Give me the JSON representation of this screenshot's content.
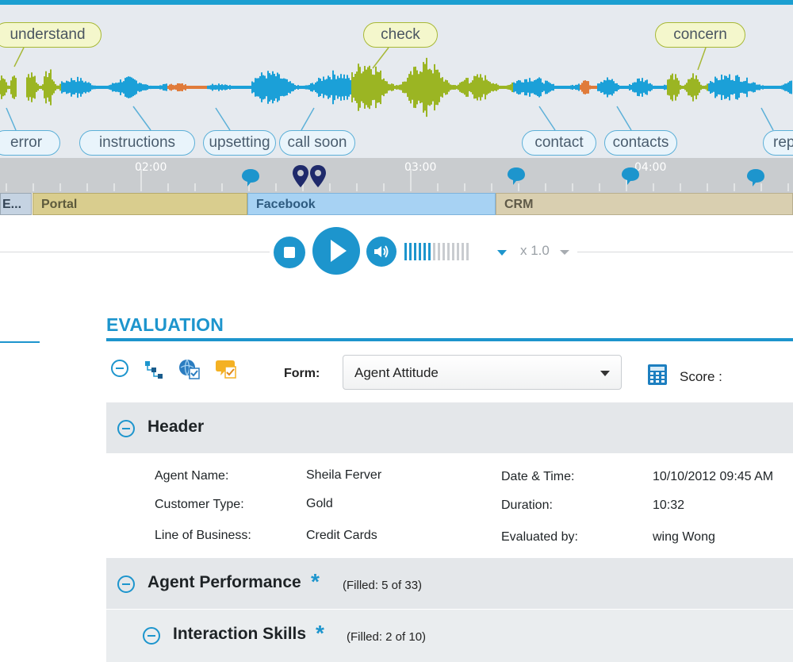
{
  "waveform": {
    "top_tags": [
      "understand",
      "check",
      "concern"
    ],
    "bottom_tags": [
      "error",
      "instructions",
      "upsetting",
      "call soon",
      "contact",
      "contacts",
      "rep"
    ],
    "colors": {
      "speech_a": "#1ba0d8",
      "speech_b": "#9bb523",
      "highlight": "#e07b3a"
    }
  },
  "timeline": {
    "times": [
      "02:00",
      "03:00",
      "04:00"
    ]
  },
  "apps": [
    {
      "label": "E...",
      "color": "#c5d3e2"
    },
    {
      "label": "Portal",
      "color": "#d9cd8e"
    },
    {
      "label": "Facebook",
      "color": "#a7d2f3"
    },
    {
      "label": "CRM",
      "color": "#d9cfb0"
    }
  ],
  "player": {
    "speed": "x 1.0",
    "volume_level": 0.4
  },
  "evaluation": {
    "title": "EVALUATION",
    "form_label": "Form:",
    "form_value": "Agent Attitude",
    "score_label": "Score :"
  },
  "sections": {
    "header": {
      "title": "Header"
    },
    "performance": {
      "title": "Agent Performance",
      "filled": "(Filled: 5 of 33)"
    },
    "skills": {
      "title": "Interaction Skills",
      "filled": "(Filled: 2 of 10)"
    }
  },
  "header_fields": {
    "agent_name_label": "Agent Name:",
    "agent_name": "Sheila Ferver",
    "customer_type_label": "Customer Type:",
    "customer_type": "Gold",
    "line_of_business_label": "Line of Business:",
    "line_of_business": "Credit Cards",
    "date_time_label": "Date & Time:",
    "date_time": "10/10/2012 09:45 AM",
    "duration_label": "Duration:",
    "duration": "10:32",
    "evaluated_by_label": "Evaluated by:",
    "evaluated_by": "wing Wong"
  }
}
